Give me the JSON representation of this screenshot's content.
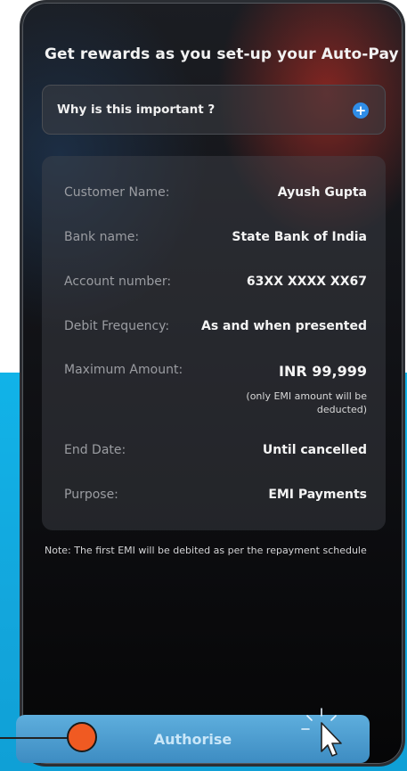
{
  "header": {
    "title": "Get rewards as you set-up your Auto-Pay"
  },
  "why": {
    "label": "Why is this important ?",
    "icon": "plus-icon"
  },
  "details": [
    {
      "label": "Customer Name:",
      "value": "Ayush Gupta"
    },
    {
      "label": "Bank name:",
      "value": "State Bank of India"
    },
    {
      "label": "Account number:",
      "value": "63XX XXXX XX67"
    },
    {
      "label": "Debit Frequency:",
      "value": "As and when presented"
    },
    {
      "label": "Maximum Amount:",
      "value": "INR 99,999",
      "subnote": "(only EMI amount will be deducted)"
    },
    {
      "label": "End Date:",
      "value": "Until cancelled"
    },
    {
      "label": "Purpose:",
      "value": "EMI Payments"
    }
  ],
  "note": "Note: The first EMI will be debited as per the repayment schedule",
  "authorise": {
    "label": "Authorise"
  },
  "colors": {
    "accent_blue": "#2f8de8",
    "button": "#4f9fd3",
    "callout": "#f05a22",
    "background_cyan": "#12abe2"
  }
}
